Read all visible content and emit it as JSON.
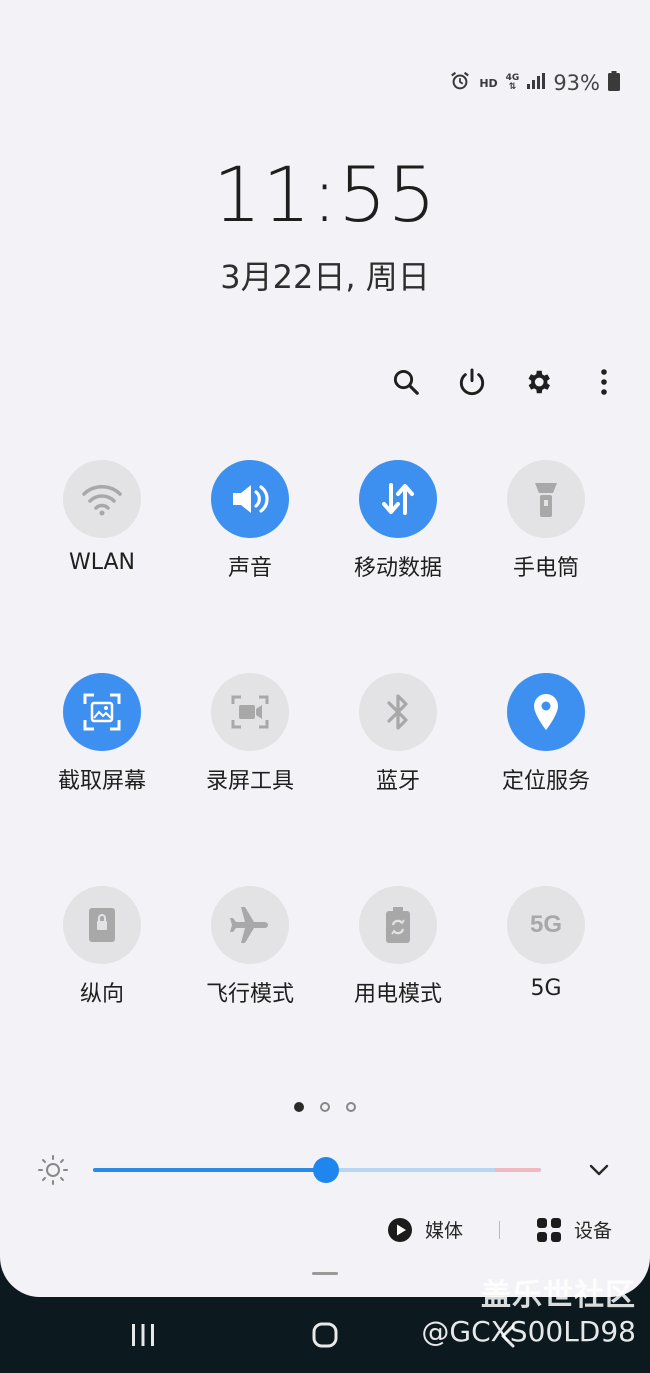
{
  "status_bar": {
    "hd": "HD",
    "network": "4G",
    "battery_percent": "93%"
  },
  "clock": {
    "time": "11:55",
    "date": "3月22日, 周日"
  },
  "tiles": [
    {
      "label": "WLAN",
      "icon": "wifi-icon",
      "on": false
    },
    {
      "label": "声音",
      "icon": "sound-icon",
      "on": true
    },
    {
      "label": "移动数据",
      "icon": "mobile-data-icon",
      "on": true
    },
    {
      "label": "手电筒",
      "icon": "flashlight-icon",
      "on": false
    },
    {
      "label": "截取屏幕",
      "icon": "screenshot-icon",
      "on": true
    },
    {
      "label": "录屏工具",
      "icon": "screen-record-icon",
      "on": false
    },
    {
      "label": "蓝牙",
      "icon": "bluetooth-icon",
      "on": false
    },
    {
      "label": "定位服务",
      "icon": "location-icon",
      "on": true
    },
    {
      "label": "纵向",
      "icon": "portrait-icon",
      "on": false
    },
    {
      "label": "飞行模式",
      "icon": "airplane-icon",
      "on": false
    },
    {
      "label": "用电模式",
      "icon": "power-mode-icon",
      "on": false
    },
    {
      "label": "5G",
      "icon": "5g-icon",
      "on": false,
      "icon_text": "5G"
    }
  ],
  "pager": {
    "pages": 3,
    "active": 0
  },
  "brightness": {
    "value": 0.52
  },
  "media_output": {
    "media_label": "媒体",
    "devices_label": "设备"
  },
  "watermark": {
    "line1": "盖乐世社区",
    "line2": "@GCXS00LD98"
  },
  "colors": {
    "accent": "#3d8ff0",
    "tile_off": "#e3e3e6",
    "panel_bg": "#f3f2f6"
  }
}
